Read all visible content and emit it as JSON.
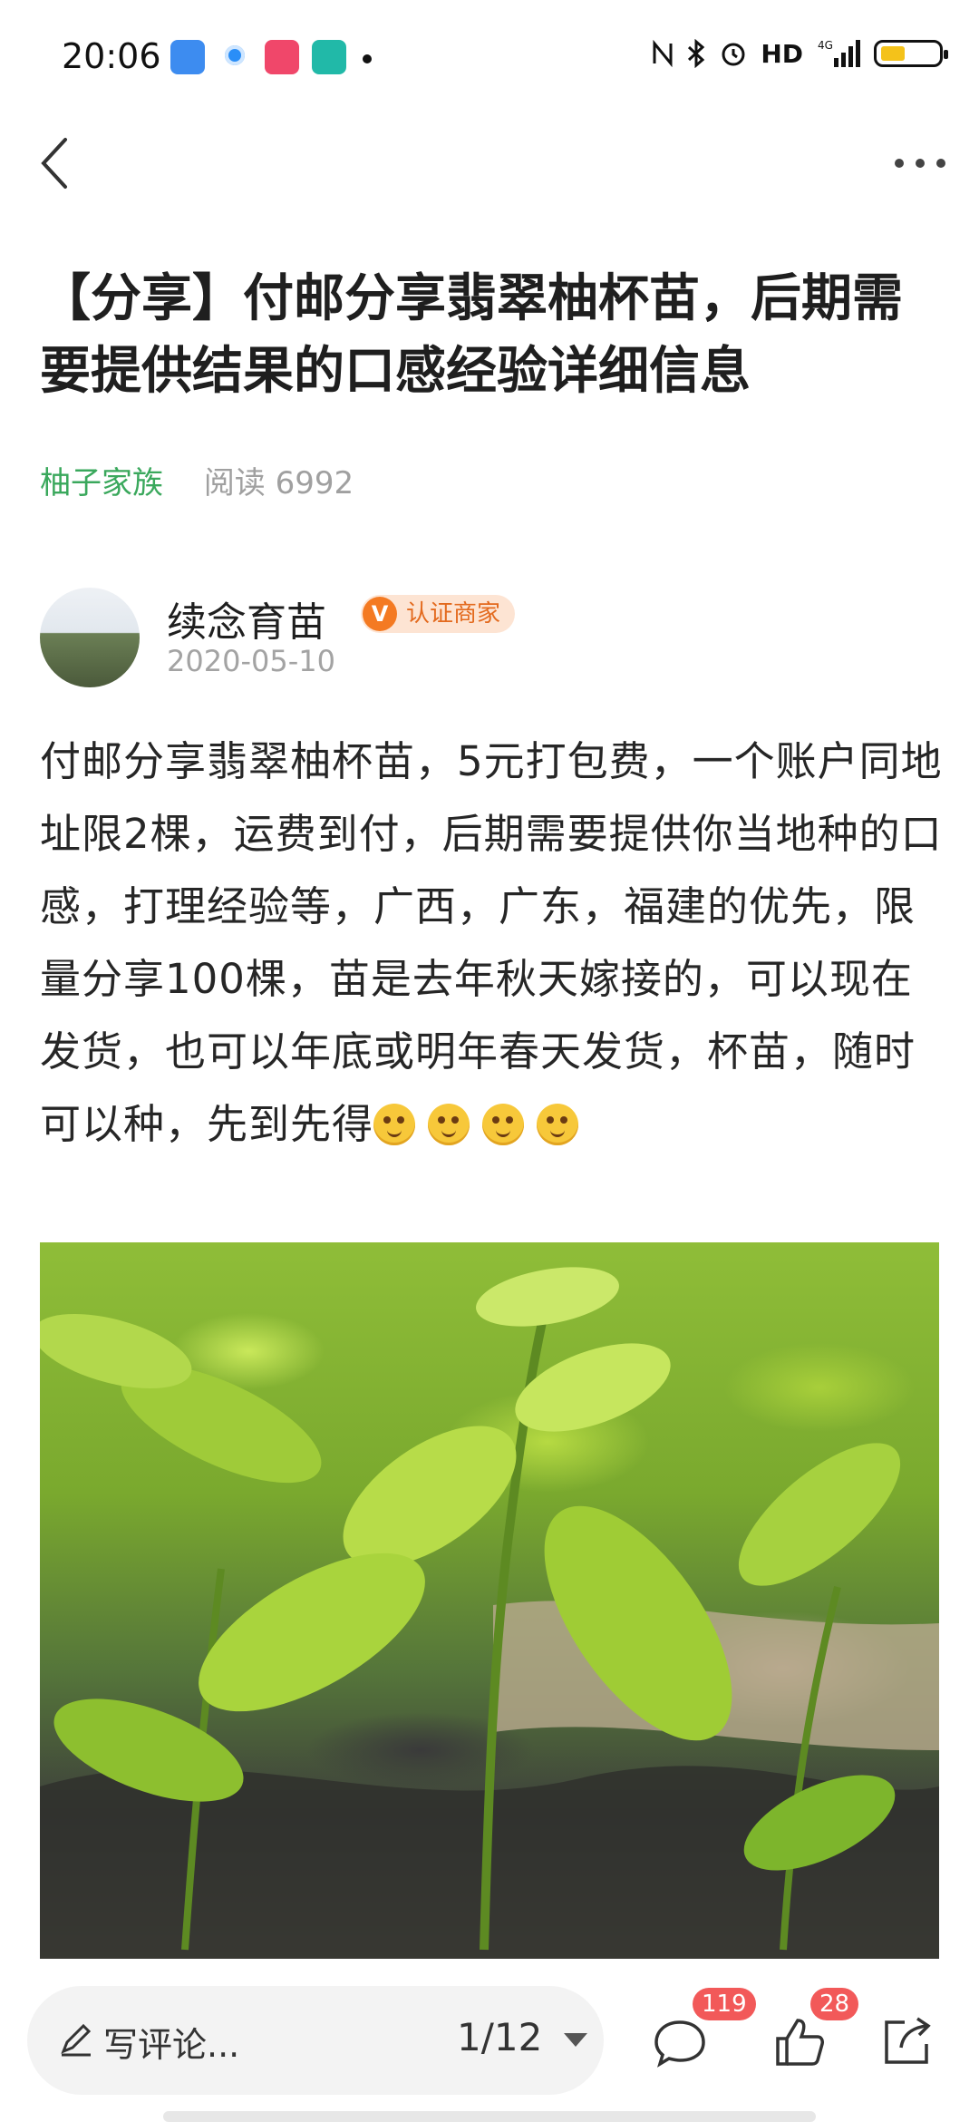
{
  "status_bar": {
    "time": "20:06",
    "network": "4G",
    "hd": "HD",
    "battery_level": 0.35,
    "battery_color": "#f4c21a"
  },
  "nav": {
    "back_icon": "chevron-left-icon",
    "more_icon": "more-dots-icon"
  },
  "article": {
    "title": "【分享】付邮分享翡翠柚杯苗，后期需要提供结果的口感经验详细信息",
    "channel": "柚子家族",
    "reads": "阅读 6992",
    "author_name": "续念育苗",
    "badge_v": "V",
    "badge_label": "认证商家",
    "date": "2020-05-10",
    "body": "付邮分享翡翠柚杯苗，5元打包费，一个账户同地址限2棵，运费到付，后期需要提供你当地种的口感，打理经验等，广西，广东，福建的优先，限量分享100棵，苗是去年秋天嫁接的，可以现在发货，也可以年底或明年春天发货，杯苗，随时可以种，先到先得",
    "emoji_count": 4
  },
  "bottom_bar": {
    "comment_placeholder": "写评论...",
    "page_indicator": "1/12",
    "comment_count": "119",
    "like_count": "28"
  },
  "colors": {
    "channel_green": "#3aa85c",
    "badge_orange": "#f47a22",
    "count_red": "#f25959"
  }
}
